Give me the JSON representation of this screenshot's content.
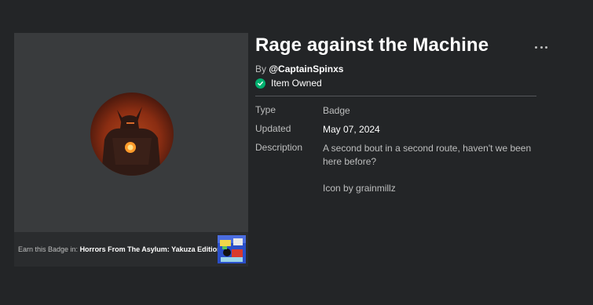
{
  "badge": {
    "title": "Rage against the Machine",
    "by_prefix": "By",
    "creator": "@CaptainSpinxs",
    "owned_label": "Item Owned"
  },
  "earn": {
    "prefix": "Earn this Badge in: ",
    "game": "Horrors From The Asylum: Yakuza Edition"
  },
  "details": {
    "type_label": "Type",
    "type_value": "Badge",
    "updated_label": "Updated",
    "updated_value": "May 07, 2024",
    "description_label": "Description",
    "description_line1": "A second bout in a second route, haven't we been here before?",
    "description_line2": "Icon by grainmillz"
  },
  "icons": {
    "more": "more-options-icon",
    "owned": "checkmark-circle-icon"
  },
  "colors": {
    "background": "#232527",
    "panel": "#393b3d",
    "owned_green": "#00b06f"
  }
}
